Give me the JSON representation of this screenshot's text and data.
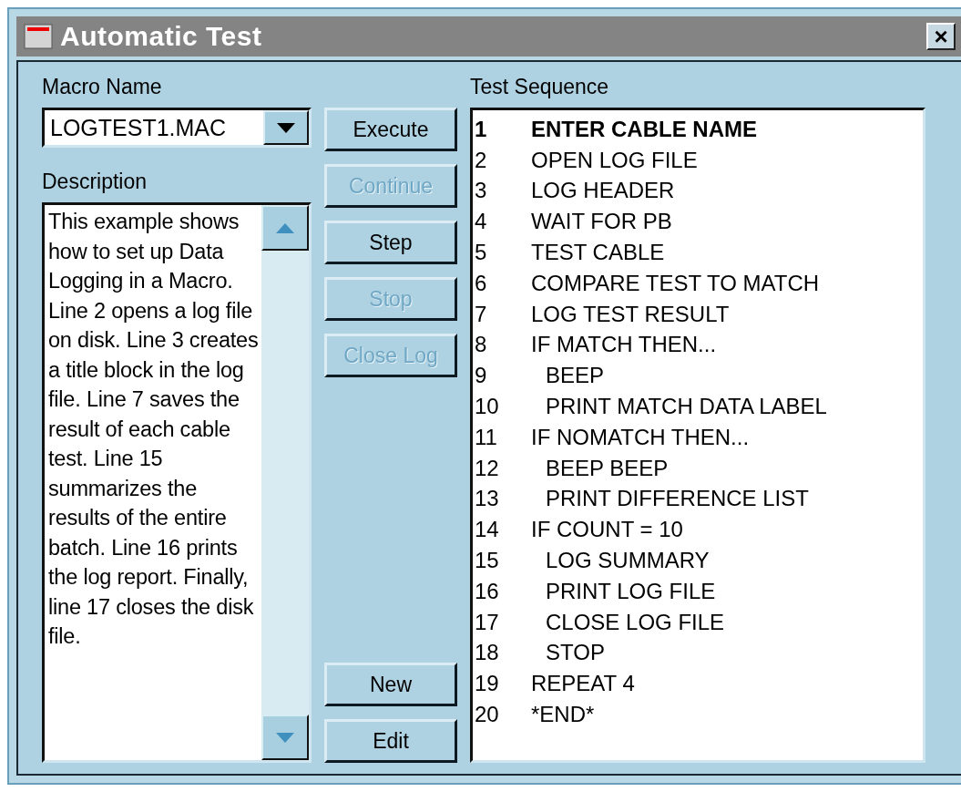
{
  "window": {
    "title": "Automatic Test",
    "close": "×"
  },
  "macro_name": {
    "label": "Macro Name",
    "value": "LOGTEST1.MAC"
  },
  "description": {
    "label": "Description",
    "text": "This example shows how to set up Data Logging in a Macro. Line 2 opens a log file on disk. Line 3 creates a title block in the log file. Line 7 saves the result of each cable test. Line 15 summarizes the results of the entire batch. Line 16 prints the log report. Finally, line 17 closes the disk file."
  },
  "buttons_top": [
    {
      "label": "Execute",
      "disabled": false
    },
    {
      "label": "Continue",
      "disabled": true
    },
    {
      "label": "Step",
      "disabled": false
    },
    {
      "label": "Stop",
      "disabled": true
    },
    {
      "label": "Close Log",
      "disabled": true
    }
  ],
  "buttons_bottom": [
    {
      "label": "New",
      "disabled": false
    },
    {
      "label": "Edit",
      "disabled": false
    }
  ],
  "sequence": {
    "label": "Test Sequence",
    "lines": [
      {
        "number": "1",
        "text": "ENTER CABLE NAME",
        "selected": true
      },
      {
        "number": "2",
        "text": "OPEN LOG FILE",
        "selected": false
      },
      {
        "number": "3",
        "text": "LOG HEADER",
        "selected": false
      },
      {
        "number": "4",
        "text": "WAIT FOR PB",
        "selected": false
      },
      {
        "number": "5",
        "text": "TEST CABLE",
        "selected": false
      },
      {
        "number": "6",
        "text": "COMPARE TEST TO MATCH",
        "selected": false
      },
      {
        "number": "7",
        "text": "LOG TEST RESULT",
        "selected": false
      },
      {
        "number": "8",
        "text": "IF MATCH THEN...",
        "selected": false,
        "children": [
          {
            "number": "9",
            "text": "BEEP",
            "selected": false
          },
          {
            "number": "10",
            "text": "PRINT MATCH DATA LABEL",
            "selected": false
          }
        ]
      },
      {
        "number": "11",
        "text": "IF NOMATCH THEN...",
        "selected": false,
        "children": [
          {
            "number": "12",
            "text": "BEEP BEEP",
            "selected": false
          },
          {
            "number": "13",
            "text": "PRINT DIFFERENCE LIST",
            "selected": false
          }
        ]
      },
      {
        "number": "14",
        "text": "IF COUNT = 10",
        "selected": false,
        "children": [
          {
            "number": "15",
            "text": "LOG SUMMARY",
            "selected": false
          },
          {
            "number": "16",
            "text": "PRINT LOG FILE",
            "selected": false
          },
          {
            "number": "17",
            "text": "CLOSE LOG FILE",
            "selected": false
          },
          {
            "number": "18",
            "text": "STOP",
            "selected": false
          }
        ]
      },
      {
        "number": "19",
        "text": "REPEAT 4",
        "selected": false
      },
      {
        "number": "20",
        "text": "*END*",
        "selected": false
      }
    ]
  }
}
